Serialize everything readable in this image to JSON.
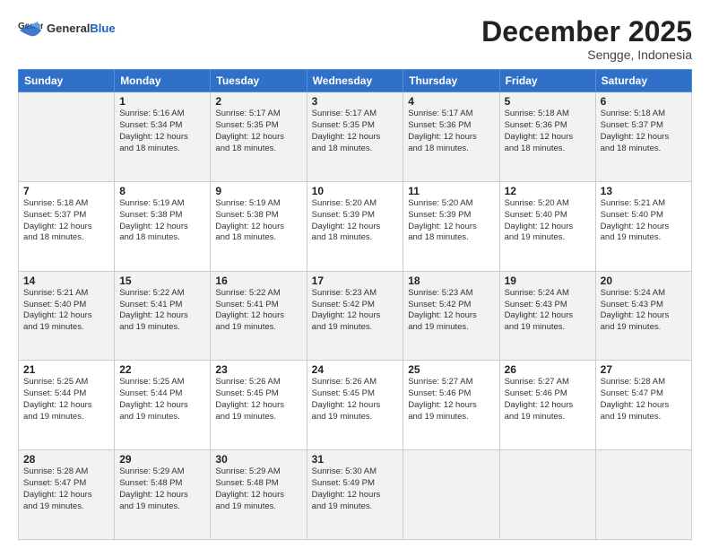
{
  "logo": {
    "general": "General",
    "blue": "Blue"
  },
  "title": "December 2025",
  "subtitle": "Sengge, Indonesia",
  "days_header": [
    "Sunday",
    "Monday",
    "Tuesday",
    "Wednesday",
    "Thursday",
    "Friday",
    "Saturday"
  ],
  "weeks": [
    [
      {
        "num": "",
        "info": ""
      },
      {
        "num": "1",
        "info": "Sunrise: 5:16 AM\nSunset: 5:34 PM\nDaylight: 12 hours\nand 18 minutes."
      },
      {
        "num": "2",
        "info": "Sunrise: 5:17 AM\nSunset: 5:35 PM\nDaylight: 12 hours\nand 18 minutes."
      },
      {
        "num": "3",
        "info": "Sunrise: 5:17 AM\nSunset: 5:35 PM\nDaylight: 12 hours\nand 18 minutes."
      },
      {
        "num": "4",
        "info": "Sunrise: 5:17 AM\nSunset: 5:36 PM\nDaylight: 12 hours\nand 18 minutes."
      },
      {
        "num": "5",
        "info": "Sunrise: 5:18 AM\nSunset: 5:36 PM\nDaylight: 12 hours\nand 18 minutes."
      },
      {
        "num": "6",
        "info": "Sunrise: 5:18 AM\nSunset: 5:37 PM\nDaylight: 12 hours\nand 18 minutes."
      }
    ],
    [
      {
        "num": "7",
        "info": "Sunrise: 5:18 AM\nSunset: 5:37 PM\nDaylight: 12 hours\nand 18 minutes."
      },
      {
        "num": "8",
        "info": "Sunrise: 5:19 AM\nSunset: 5:38 PM\nDaylight: 12 hours\nand 18 minutes."
      },
      {
        "num": "9",
        "info": "Sunrise: 5:19 AM\nSunset: 5:38 PM\nDaylight: 12 hours\nand 18 minutes."
      },
      {
        "num": "10",
        "info": "Sunrise: 5:20 AM\nSunset: 5:39 PM\nDaylight: 12 hours\nand 18 minutes."
      },
      {
        "num": "11",
        "info": "Sunrise: 5:20 AM\nSunset: 5:39 PM\nDaylight: 12 hours\nand 18 minutes."
      },
      {
        "num": "12",
        "info": "Sunrise: 5:20 AM\nSunset: 5:40 PM\nDaylight: 12 hours\nand 19 minutes."
      },
      {
        "num": "13",
        "info": "Sunrise: 5:21 AM\nSunset: 5:40 PM\nDaylight: 12 hours\nand 19 minutes."
      }
    ],
    [
      {
        "num": "14",
        "info": "Sunrise: 5:21 AM\nSunset: 5:40 PM\nDaylight: 12 hours\nand 19 minutes."
      },
      {
        "num": "15",
        "info": "Sunrise: 5:22 AM\nSunset: 5:41 PM\nDaylight: 12 hours\nand 19 minutes."
      },
      {
        "num": "16",
        "info": "Sunrise: 5:22 AM\nSunset: 5:41 PM\nDaylight: 12 hours\nand 19 minutes."
      },
      {
        "num": "17",
        "info": "Sunrise: 5:23 AM\nSunset: 5:42 PM\nDaylight: 12 hours\nand 19 minutes."
      },
      {
        "num": "18",
        "info": "Sunrise: 5:23 AM\nSunset: 5:42 PM\nDaylight: 12 hours\nand 19 minutes."
      },
      {
        "num": "19",
        "info": "Sunrise: 5:24 AM\nSunset: 5:43 PM\nDaylight: 12 hours\nand 19 minutes."
      },
      {
        "num": "20",
        "info": "Sunrise: 5:24 AM\nSunset: 5:43 PM\nDaylight: 12 hours\nand 19 minutes."
      }
    ],
    [
      {
        "num": "21",
        "info": "Sunrise: 5:25 AM\nSunset: 5:44 PM\nDaylight: 12 hours\nand 19 minutes."
      },
      {
        "num": "22",
        "info": "Sunrise: 5:25 AM\nSunset: 5:44 PM\nDaylight: 12 hours\nand 19 minutes."
      },
      {
        "num": "23",
        "info": "Sunrise: 5:26 AM\nSunset: 5:45 PM\nDaylight: 12 hours\nand 19 minutes."
      },
      {
        "num": "24",
        "info": "Sunrise: 5:26 AM\nSunset: 5:45 PM\nDaylight: 12 hours\nand 19 minutes."
      },
      {
        "num": "25",
        "info": "Sunrise: 5:27 AM\nSunset: 5:46 PM\nDaylight: 12 hours\nand 19 minutes."
      },
      {
        "num": "26",
        "info": "Sunrise: 5:27 AM\nSunset: 5:46 PM\nDaylight: 12 hours\nand 19 minutes."
      },
      {
        "num": "27",
        "info": "Sunrise: 5:28 AM\nSunset: 5:47 PM\nDaylight: 12 hours\nand 19 minutes."
      }
    ],
    [
      {
        "num": "28",
        "info": "Sunrise: 5:28 AM\nSunset: 5:47 PM\nDaylight: 12 hours\nand 19 minutes."
      },
      {
        "num": "29",
        "info": "Sunrise: 5:29 AM\nSunset: 5:48 PM\nDaylight: 12 hours\nand 19 minutes."
      },
      {
        "num": "30",
        "info": "Sunrise: 5:29 AM\nSunset: 5:48 PM\nDaylight: 12 hours\nand 19 minutes."
      },
      {
        "num": "31",
        "info": "Sunrise: 5:30 AM\nSunset: 5:49 PM\nDaylight: 12 hours\nand 19 minutes."
      },
      {
        "num": "",
        "info": ""
      },
      {
        "num": "",
        "info": ""
      },
      {
        "num": "",
        "info": ""
      }
    ]
  ]
}
